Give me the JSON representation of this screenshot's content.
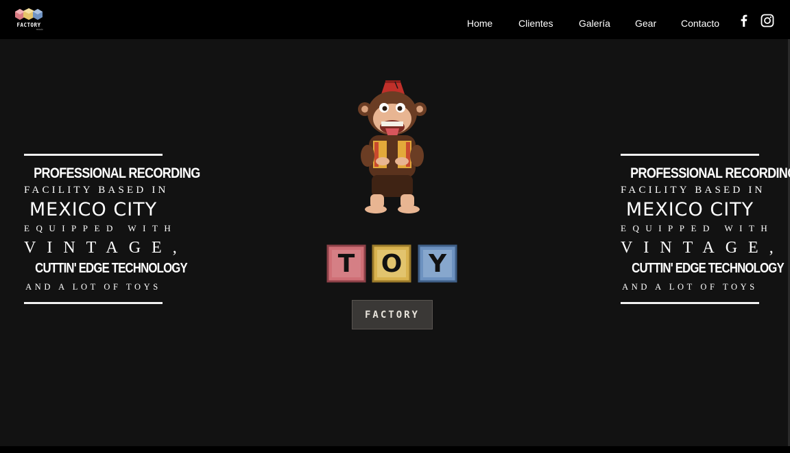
{
  "brand": {
    "logo_text": "FACTORY",
    "logo_subtext": "music",
    "colors": {
      "cube_red": "#d97a82",
      "cube_yellow": "#e5c46a",
      "cube_blue": "#6f93c2"
    }
  },
  "nav": {
    "items": [
      {
        "label": "Home"
      },
      {
        "label": "Clientes"
      },
      {
        "label": "Galería"
      },
      {
        "label": "Gear"
      },
      {
        "label": "Contacto"
      }
    ],
    "social": [
      {
        "icon": "facebook-icon"
      },
      {
        "icon": "instagram-icon"
      }
    ]
  },
  "tagline": {
    "line1": "PROFESSIONAL RECORDING",
    "line2": "FACILITY BASED IN",
    "line3": "MEXICO CITY",
    "line4": "EQUIPPED WITH",
    "line5": "VINTAGE,",
    "line6": "CUTTIN' EDGE TECHNOLOGY",
    "line7": "AND A LOT OF TOYS"
  },
  "hero": {
    "blocks": [
      {
        "letter": "T",
        "color": "#cf6f76"
      },
      {
        "letter": "O",
        "color": "#d9b34f"
      },
      {
        "letter": "Y",
        "color": "#6d92c0"
      }
    ],
    "plate_label": "FACTORY"
  },
  "colors": {
    "header_bg": "#000000",
    "body_bg": "#121212",
    "text": "#ffffff"
  }
}
